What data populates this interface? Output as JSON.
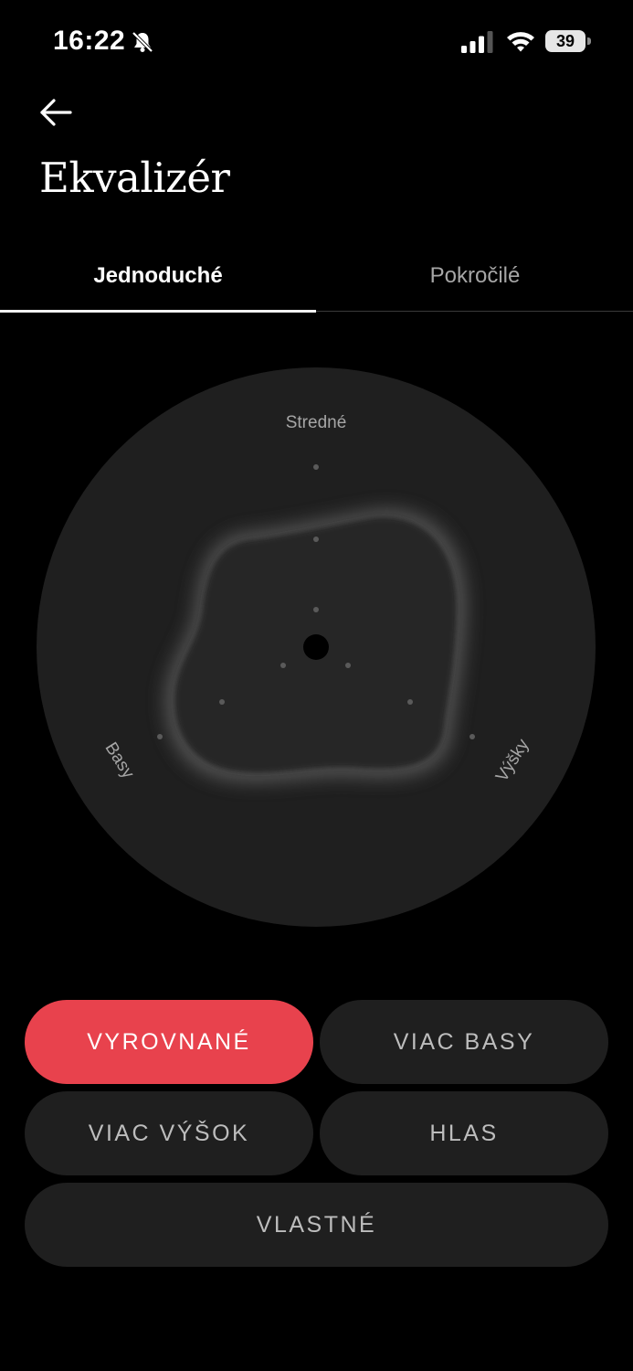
{
  "status_bar": {
    "time": "16:22",
    "battery_level": "39",
    "icons": [
      "bell-slash-icon",
      "cellular-signal-icon",
      "wifi-icon",
      "battery-icon"
    ]
  },
  "header": {
    "back_icon": "arrow-left-icon",
    "title": "Ekvalizér"
  },
  "tabs": [
    {
      "label": "Jednoduché",
      "active": true
    },
    {
      "label": "Pokročilé",
      "active": false
    }
  ],
  "equalizer": {
    "labels": {
      "top": "Stredné",
      "left": "Basy",
      "right": "Výšky"
    },
    "colors": {
      "disc": "#1f1f1f",
      "shape": "#2a2a2a",
      "center": "#000000"
    }
  },
  "presets": [
    {
      "label": "VYROVNANÉ",
      "active": true
    },
    {
      "label": "VIAC BASY",
      "active": false
    },
    {
      "label": "VIAC VÝŠOK",
      "active": false
    },
    {
      "label": "HLAS",
      "active": false
    },
    {
      "label": "VLASTNÉ",
      "active": false
    }
  ],
  "colors": {
    "background": "#000000",
    "accent": "#e8424d",
    "button": "#1f1f1f"
  }
}
